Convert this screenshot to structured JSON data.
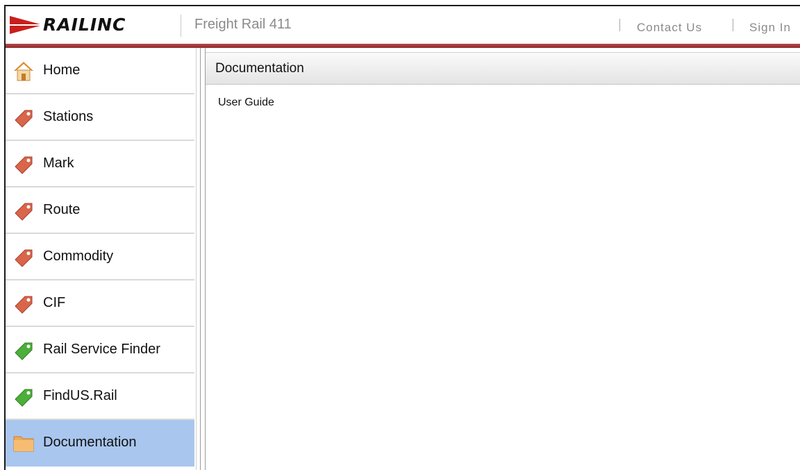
{
  "header": {
    "logo_text": "RAILINC",
    "app_title": "Freight Rail 411",
    "links": [
      {
        "label": "Contact Us"
      },
      {
        "label": "Sign In"
      }
    ],
    "bar_color": "#9b3333"
  },
  "sidebar": {
    "active_color": "#a9c6ee",
    "items": [
      {
        "label": "Home",
        "icon": "home-icon"
      },
      {
        "label": "Stations",
        "icon": "tag-icon"
      },
      {
        "label": "Mark",
        "icon": "tag-icon"
      },
      {
        "label": "Route",
        "icon": "tag-icon"
      },
      {
        "label": "Commodity",
        "icon": "tag-icon"
      },
      {
        "label": "CIF",
        "icon": "tag-icon"
      },
      {
        "label": "Rail Service Finder",
        "icon": "green-tag-icon"
      },
      {
        "label": "FindUS.Rail",
        "icon": "green-tag-icon"
      },
      {
        "label": "Documentation",
        "icon": "folder-icon",
        "active": true
      }
    ]
  },
  "main": {
    "title": "Documentation",
    "links": [
      {
        "label": "User Guide"
      }
    ]
  }
}
